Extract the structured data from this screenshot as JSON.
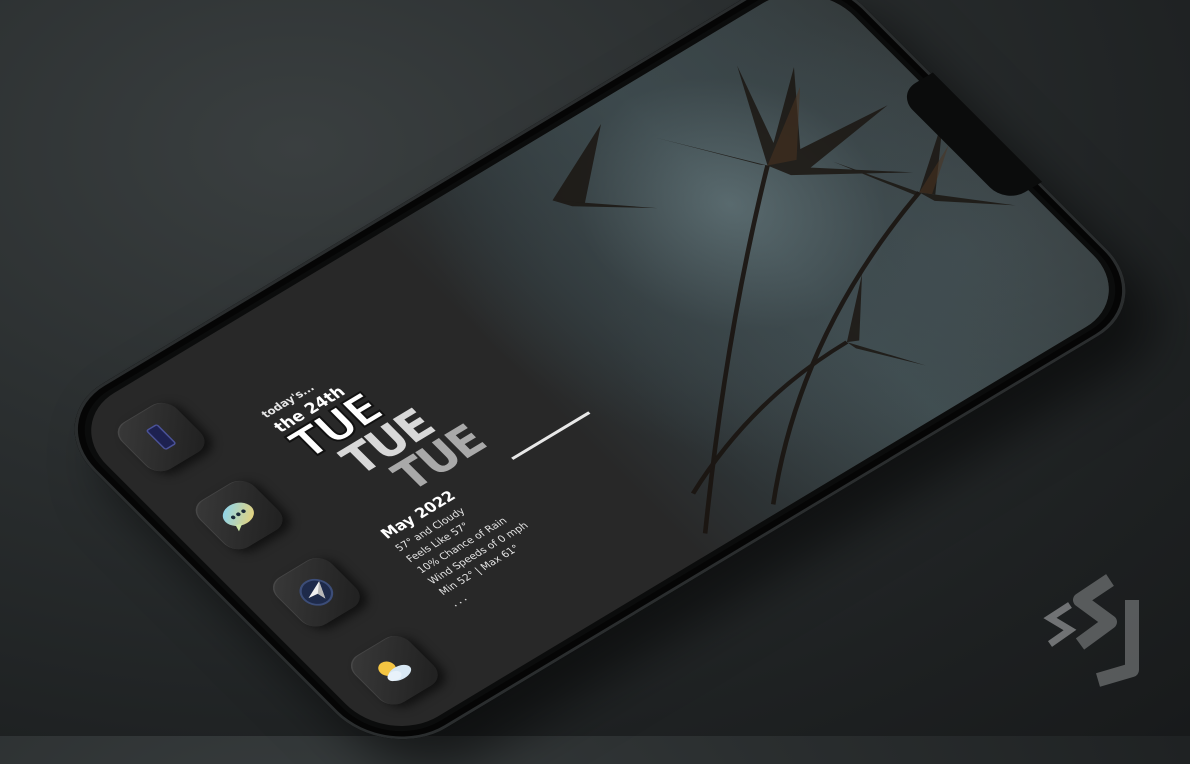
{
  "widget": {
    "today_label": "today's...",
    "date_label": "the 24th",
    "day_abbr": "TUE",
    "month_year": "May 2022",
    "weather_lines": [
      "57° and Cloudy",
      "Feels Like 57°",
      "10% Chance of Rain",
      "Wind Speeds of 0 mph",
      "Min 52° | Max 61°"
    ],
    "more": "..."
  },
  "dock": {
    "apps": [
      {
        "icon": "phone-icon"
      },
      {
        "icon": "messages-icon"
      },
      {
        "icon": "compass-icon"
      },
      {
        "icon": "weather-icon"
      }
    ]
  },
  "colors": {
    "background": "#2a2e2f",
    "screen": "#282828",
    "bezel": "#0b0c0c",
    "messages_gradient": [
      "#7fd4ff",
      "#f4d36a"
    ],
    "weather_sun": "#f4c542"
  }
}
